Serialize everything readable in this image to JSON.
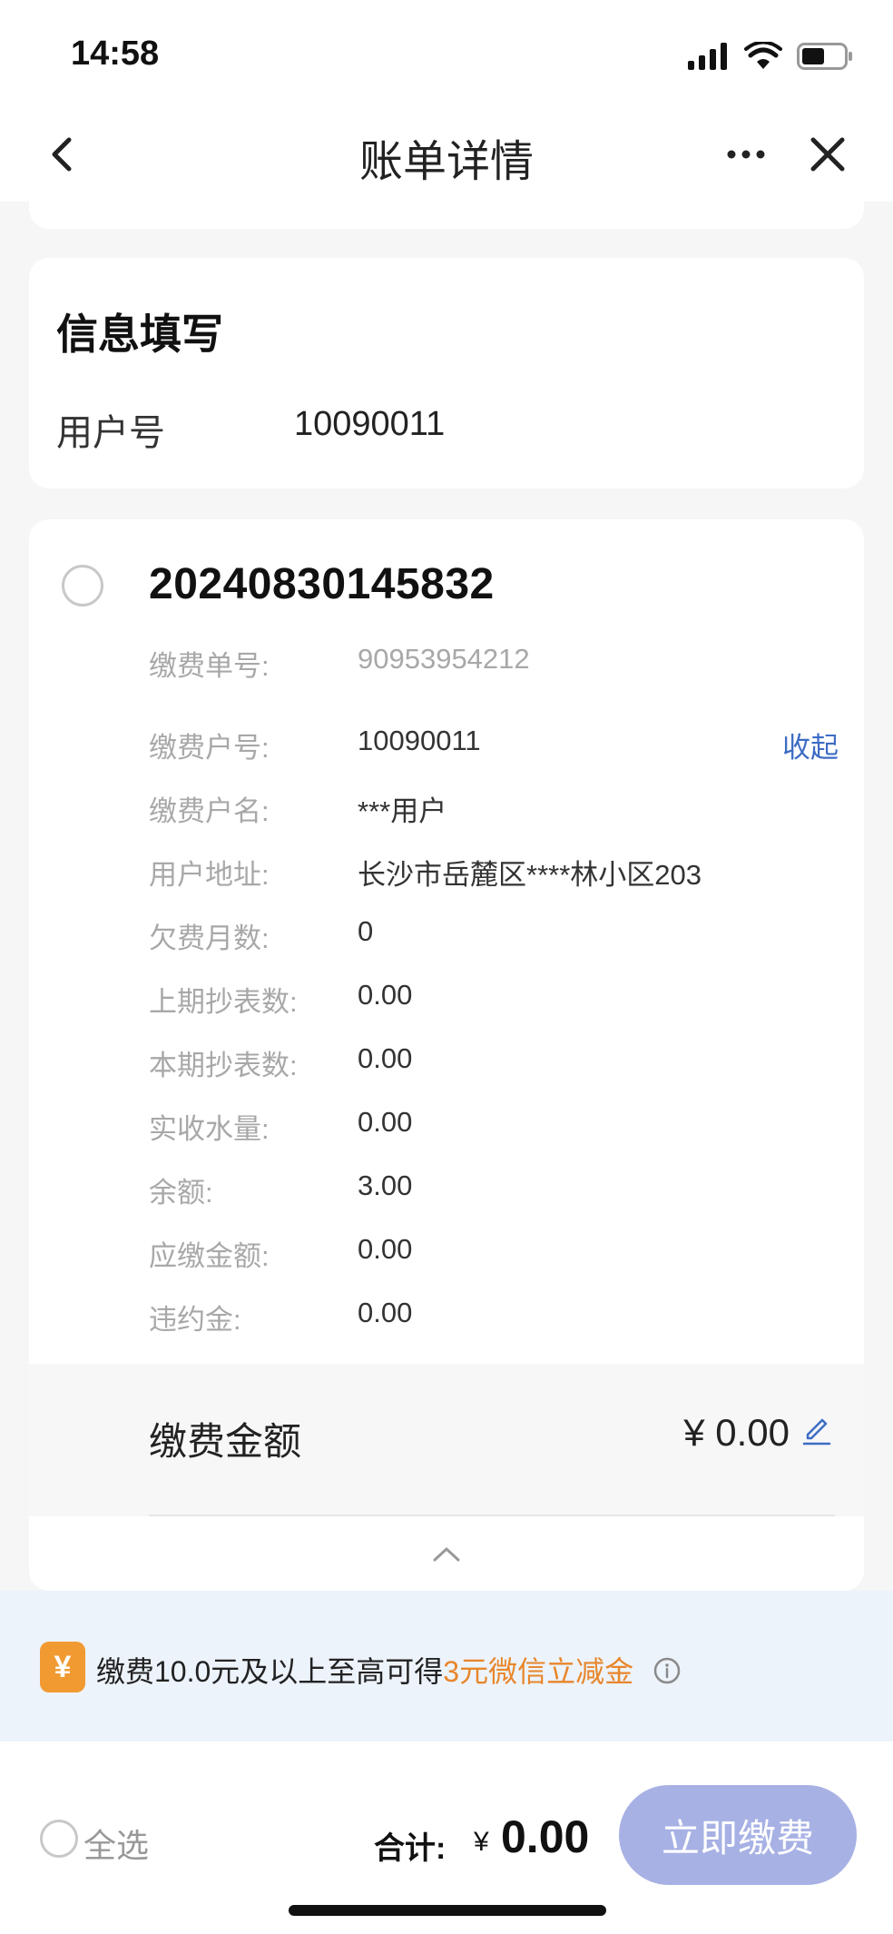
{
  "status_bar": {
    "time": "14:58"
  },
  "nav": {
    "title": "账单详情"
  },
  "info_card": {
    "title": "信息填写",
    "user_label": "用户号",
    "user_value": "10090011"
  },
  "bill": {
    "number": "20240830145832",
    "collapse_label": "收起",
    "details": [
      {
        "label": "缴费单号:",
        "value": "90953954212"
      },
      {
        "label": "缴费户号:",
        "value": "10090011"
      },
      {
        "label": "缴费户名:",
        "value": "***用户"
      },
      {
        "label": "用户地址:",
        "value": "长沙市岳麓区****林小区203"
      },
      {
        "label": "欠费月数:",
        "value": "0"
      },
      {
        "label": "上期抄表数:",
        "value": "0.00"
      },
      {
        "label": "本期抄表数:",
        "value": "0.00"
      },
      {
        "label": "实收水量:",
        "value": "0.00"
      },
      {
        "label": "余额:",
        "value": "3.00"
      },
      {
        "label": "应缴金额:",
        "value": "0.00"
      },
      {
        "label": "违约金:",
        "value": "0.00"
      }
    ],
    "amount_label": "缴费金额",
    "amount_value": "¥ 0.00"
  },
  "promo": {
    "icon_text": "¥",
    "text_prefix": "缴费10.0元及以上至高可得",
    "text_highlight": "3元微信立减金"
  },
  "bottom": {
    "select_all": "全选",
    "total_label": "合计:",
    "total_currency": "¥",
    "total_value": "0.00",
    "pay_button": "立即缴费"
  },
  "colors": {
    "accent_link": "#3d6cc4",
    "promo_orange": "#e8862b",
    "pay_button_disabled": "#a7b1e4"
  }
}
